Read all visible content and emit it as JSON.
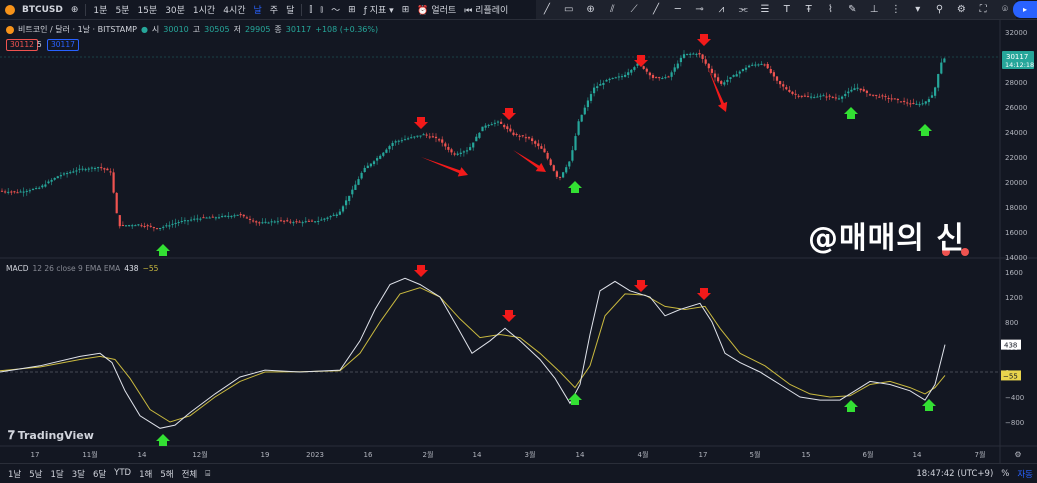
{
  "topbar": {
    "symbol": "BTCUSD",
    "intervals": [
      "1분",
      "5분",
      "15분",
      "30분",
      "1시간",
      "4시간",
      "날",
      "주",
      "달"
    ],
    "active_interval": "날",
    "indicators_label": "지표",
    "alert_label": "얼러트",
    "replay_label": "리플레이"
  },
  "legend": {
    "title": "비트코인 / 달러 · 1날 · BITSTAMP",
    "open_label": "시",
    "open": "30010",
    "high_label": "고",
    "high": "30505",
    "low_label": "저",
    "low": "29905",
    "close_label": "종",
    "close": "30117",
    "change": "+108 (+0.36%)",
    "bid": "30112",
    "spread": "5",
    "ask": "30117"
  },
  "price_axis": {
    "labels": [
      "32000",
      "30000",
      "28000",
      "26000",
      "24000",
      "22000",
      "20000",
      "18000",
      "16000",
      "14000"
    ],
    "last_price": "30117",
    "countdown": "14:12:18"
  },
  "macd": {
    "name": "MACD",
    "params": "12 26 close 9 EMA EMA",
    "value1": "438",
    "value2": "−55",
    "axis_labels": [
      "1600",
      "1200",
      "800",
      "400",
      "0",
      "−400",
      "−800"
    ],
    "tag_macd": "438",
    "tag_signal": "−55"
  },
  "time_axis": {
    "labels": [
      "17",
      "11월",
      "14",
      "12월",
      "19",
      "2023",
      "16",
      "2월",
      "14",
      "3월",
      "14",
      "4월",
      "17",
      "5월",
      "15",
      "6월",
      "14",
      "7월"
    ]
  },
  "watermark": "@매매의 신",
  "logo": "TradingView",
  "bottombar": {
    "ranges": [
      "1날",
      "5날",
      "1달",
      "3달",
      "6달",
      "YTD",
      "1해",
      "5해",
      "전체"
    ],
    "clock": "18:47:42 (UTC+9)",
    "percent": "%",
    "auto": "자동"
  },
  "colors": {
    "up": "#26a69a",
    "down": "#ef5350",
    "macd": "#e0e3eb",
    "signal": "#c9b93f",
    "arrow_red": "#f21a1a",
    "arrow_green": "#33e033"
  }
}
